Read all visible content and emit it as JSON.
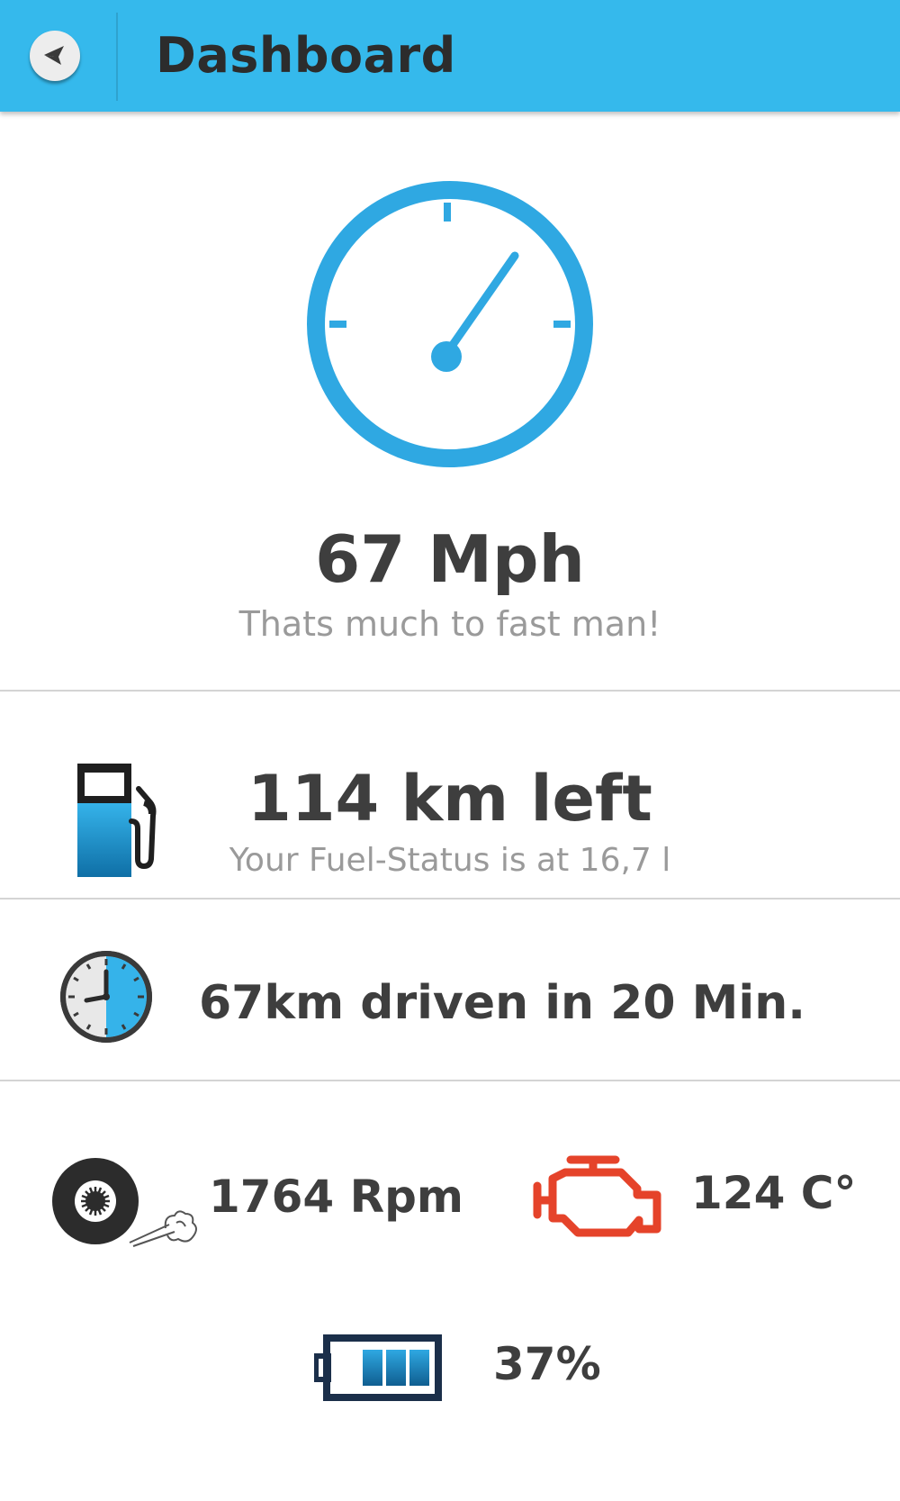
{
  "header": {
    "title": "Dashboard",
    "back_icon": "back-arrow-icon",
    "background_color": "#35b9ec"
  },
  "speed": {
    "value": "67 Mph",
    "message": "Thats much to fast man!",
    "icon": "speedometer-icon",
    "accent_color": "#2fa8e2"
  },
  "fuel": {
    "range": "114 km left",
    "status": "Your Fuel-Status is at 16,7 l",
    "icon": "fuel-pump-icon"
  },
  "trip": {
    "summary": "67km driven in 20 Min.",
    "icon": "clock-icon"
  },
  "engine": {
    "rpm": "1764 Rpm",
    "rpm_icon": "tire-icon",
    "temperature": "124 C°",
    "temperature_icon": "engine-icon",
    "warning_color": "#e5432a"
  },
  "battery": {
    "level": "37%",
    "icon": "battery-icon"
  }
}
